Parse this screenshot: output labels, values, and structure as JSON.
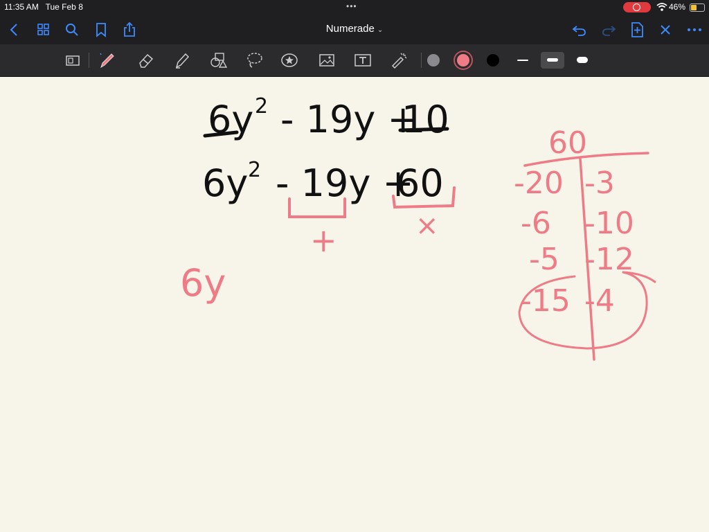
{
  "status": {
    "time": "11:35 AM",
    "date": "Tue Feb 8",
    "dots": "•••",
    "battery_percent": "46%",
    "battery_level": 0.46
  },
  "nav": {
    "title": "Numerade"
  },
  "toolbar": {
    "tools": [
      "page-thumbnail-icon",
      "pen-icon",
      "eraser-icon",
      "highlighter-icon",
      "shapes-icon",
      "lasso-icon",
      "sticker-star-icon",
      "image-icon",
      "text-box-icon",
      "laser-pointer-icon"
    ],
    "colors": [
      "#8a8a8e",
      "#ee7b86",
      "#000000"
    ],
    "selected_color": "#ee7b86"
  },
  "note": {
    "line1": {
      "left": "6y",
      "sup": "2",
      "middle": "- 19y +",
      "right": "10"
    },
    "line2": {
      "left": "6y",
      "sup": "2",
      "middle": "- 19y +",
      "right": "60"
    },
    "bracket1_symbol": "+",
    "bracket2_symbol": "×",
    "side_term": "6y",
    "table_header": "60",
    "table_left": [
      "-20",
      "-6",
      "-5",
      "-15"
    ],
    "table_right": [
      "-3",
      "-10",
      "-12",
      "-4"
    ],
    "ink_black": "#111111",
    "ink_pink": "#ee7b86"
  }
}
